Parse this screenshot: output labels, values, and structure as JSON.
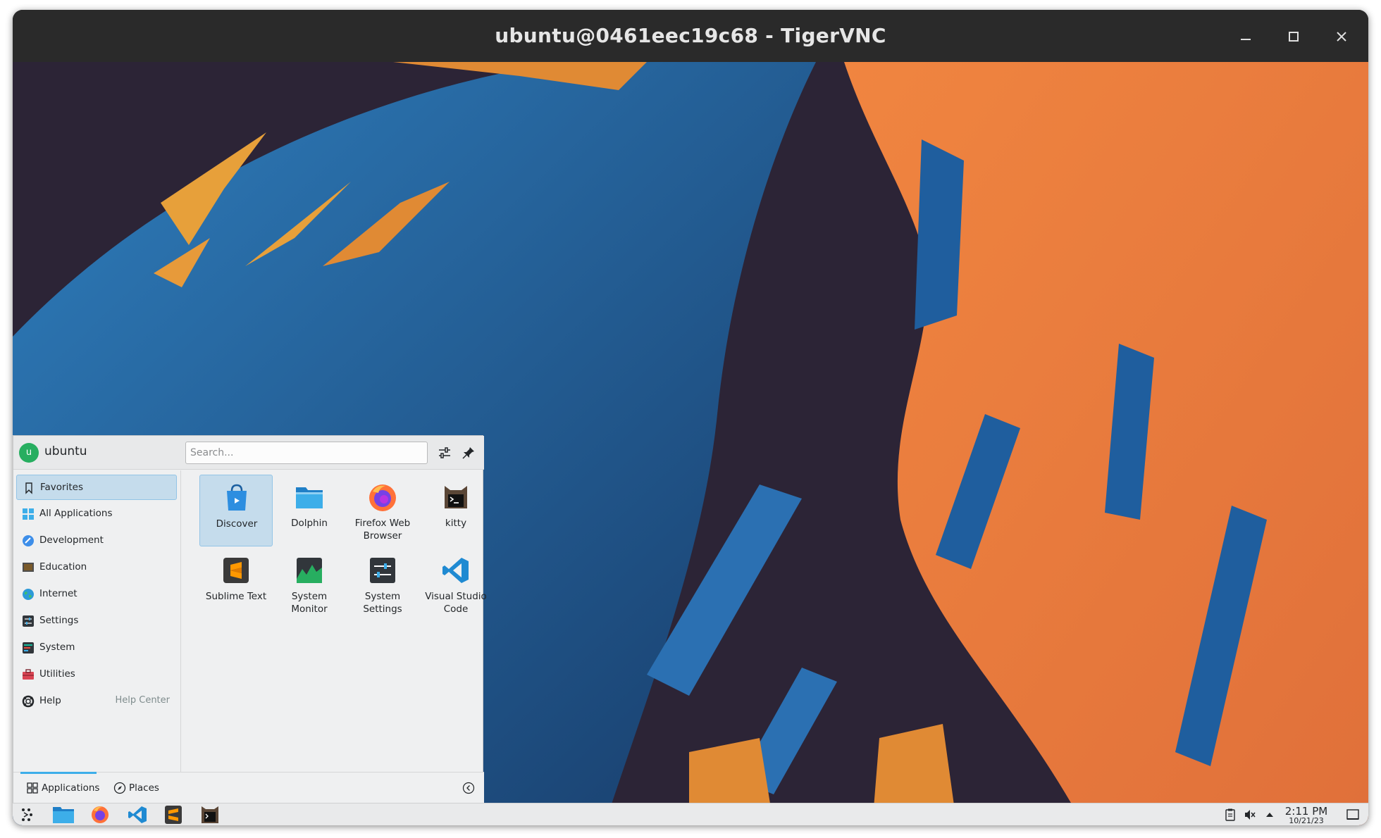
{
  "window": {
    "title": "ubuntu@0461eec19c68 - TigerVNC",
    "controls": [
      "minimize-icon",
      "maximize-icon",
      "close-icon"
    ]
  },
  "menu": {
    "user": {
      "initial": "u",
      "name": "ubuntu"
    },
    "search": {
      "placeholder": "Search...",
      "value": ""
    },
    "header_icons": [
      "filter-icon",
      "pin-icon"
    ],
    "categories": [
      {
        "label": "Favorites",
        "icon": "bookmark-icon",
        "active": true
      },
      {
        "label": "All Applications",
        "icon": "grid-icon"
      },
      {
        "label": "Development",
        "icon": "development-icon"
      },
      {
        "label": "Education",
        "icon": "education-icon"
      },
      {
        "label": "Internet",
        "icon": "globe-icon"
      },
      {
        "label": "Settings",
        "icon": "settings-icon"
      },
      {
        "label": "System",
        "icon": "system-icon"
      },
      {
        "label": "Utilities",
        "icon": "toolbox-icon"
      },
      {
        "label": "Help",
        "icon": "lifebuoy-icon",
        "sublabel": "Help Center"
      }
    ],
    "apps": [
      {
        "label": "Discover",
        "icon": "discover-icon",
        "active": true
      },
      {
        "label": "Dolphin",
        "icon": "folder-icon"
      },
      {
        "label": "Firefox Web Browser",
        "icon": "firefox-icon"
      },
      {
        "label": "kitty",
        "icon": "kitty-icon"
      },
      {
        "label": "Sublime Text",
        "icon": "sublime-icon"
      },
      {
        "label": "System Monitor",
        "icon": "system-monitor-icon"
      },
      {
        "label": "System Settings",
        "icon": "system-settings-icon"
      },
      {
        "label": "Visual Studio Code",
        "icon": "vscode-icon"
      }
    ],
    "footer": {
      "tabs": [
        {
          "label": "Applications",
          "icon": "grid-icon",
          "active": true
        },
        {
          "label": "Places",
          "icon": "compass-icon"
        }
      ]
    }
  },
  "taskbar": {
    "launchers": [
      "app-launcher-icon",
      "folder-icon",
      "firefox-icon",
      "vscode-icon",
      "sublime-icon",
      "kitty-icon"
    ],
    "tray": [
      "clipboard-icon",
      "volume-muted-icon",
      "chevron-up-icon"
    ],
    "clock": {
      "time": "2:11 PM",
      "date": "10/21/23"
    },
    "show_desktop": "show-desktop-icon"
  },
  "colors": {
    "accent": "#3daee9",
    "selection": "#c5dcec",
    "titlebar": "#2a2a2a",
    "wallpaper_orange": "#f08a3c",
    "wallpaper_blue": "#1f64a8"
  }
}
